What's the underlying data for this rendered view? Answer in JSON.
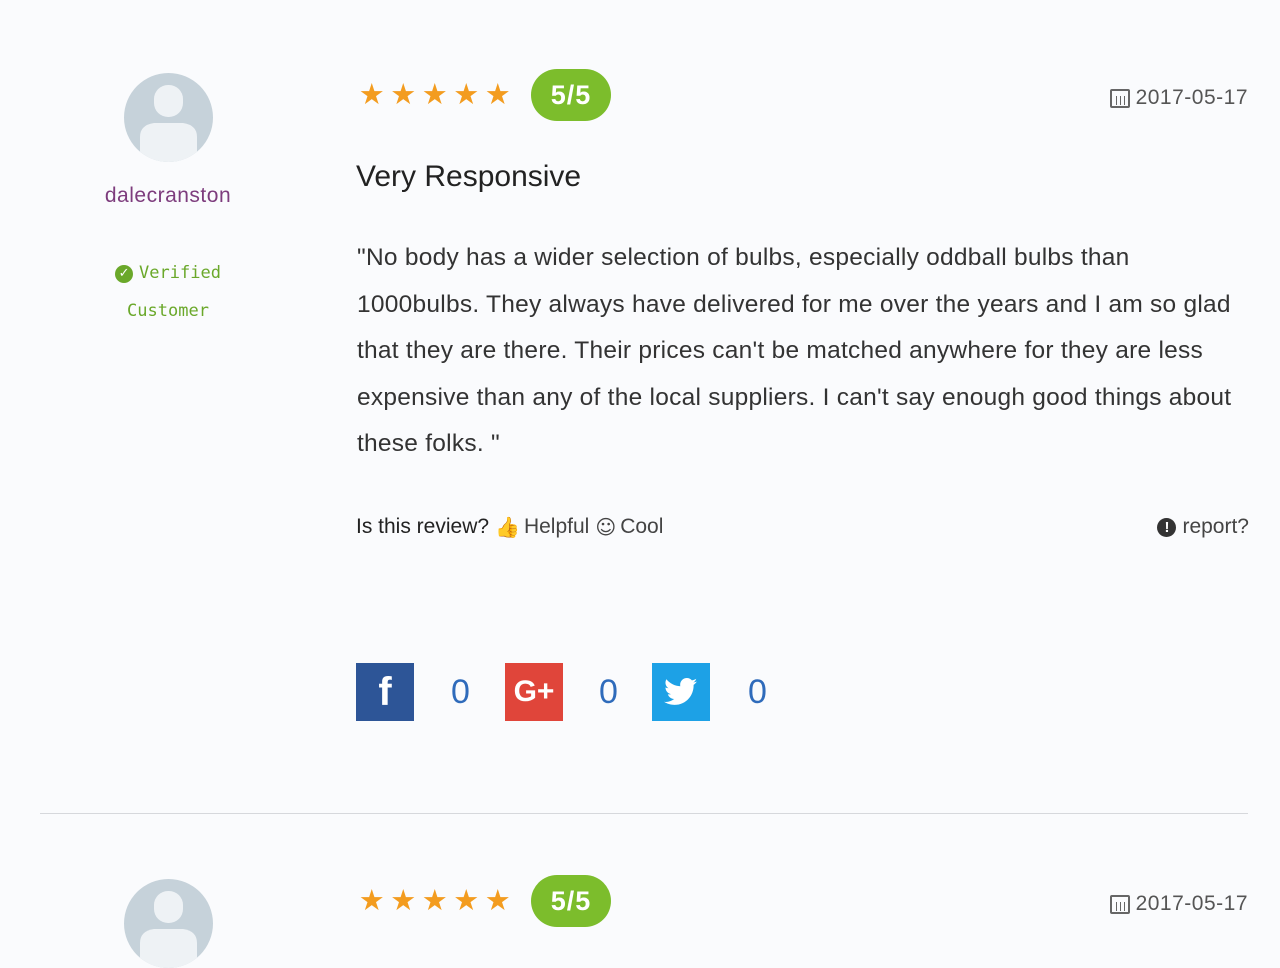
{
  "reviews": [
    {
      "username": "dalecranston",
      "verified_line1": "Verified",
      "verified_line2": "Customer",
      "score": "5/5",
      "date": "2017-05-17",
      "title": "Very Responsive",
      "body": "\"No body has a wider selection of bulbs, especially oddball bulbs than 1000bulbs. They always have delivered for me over the years and I am so glad that they are there. Their prices can't be matched anywhere for they are less expensive than any of the local suppliers. I can't say enough good things about these folks. \"",
      "vote_prompt": "Is this review?",
      "helpful_label": "Helpful",
      "cool_label": "Cool",
      "report_label": "report?",
      "share": {
        "facebook_count": "0",
        "googleplus_count": "0",
        "twitter_count": "0"
      }
    },
    {
      "score": "5/5",
      "date": "2017-05-17"
    }
  ],
  "colors": {
    "star": "#f39c1f",
    "score_badge": "#7cbd2c",
    "username": "#7d3c7d",
    "verified": "#6aa82a",
    "facebook": "#2d5597",
    "googleplus": "#e0453a",
    "twitter": "#1da1e6",
    "count": "#2f6bbb"
  },
  "icons": {
    "avatar": "user-silhouette-icon",
    "verified": "check-circle-icon",
    "star": "star-icon",
    "date": "calendar-icon",
    "helpful": "thumbs-up-icon",
    "cool": "smiley-icon",
    "report": "exclamation-circle-icon",
    "facebook": "facebook-icon",
    "googleplus": "google-plus-icon",
    "twitter": "twitter-bird-icon"
  }
}
